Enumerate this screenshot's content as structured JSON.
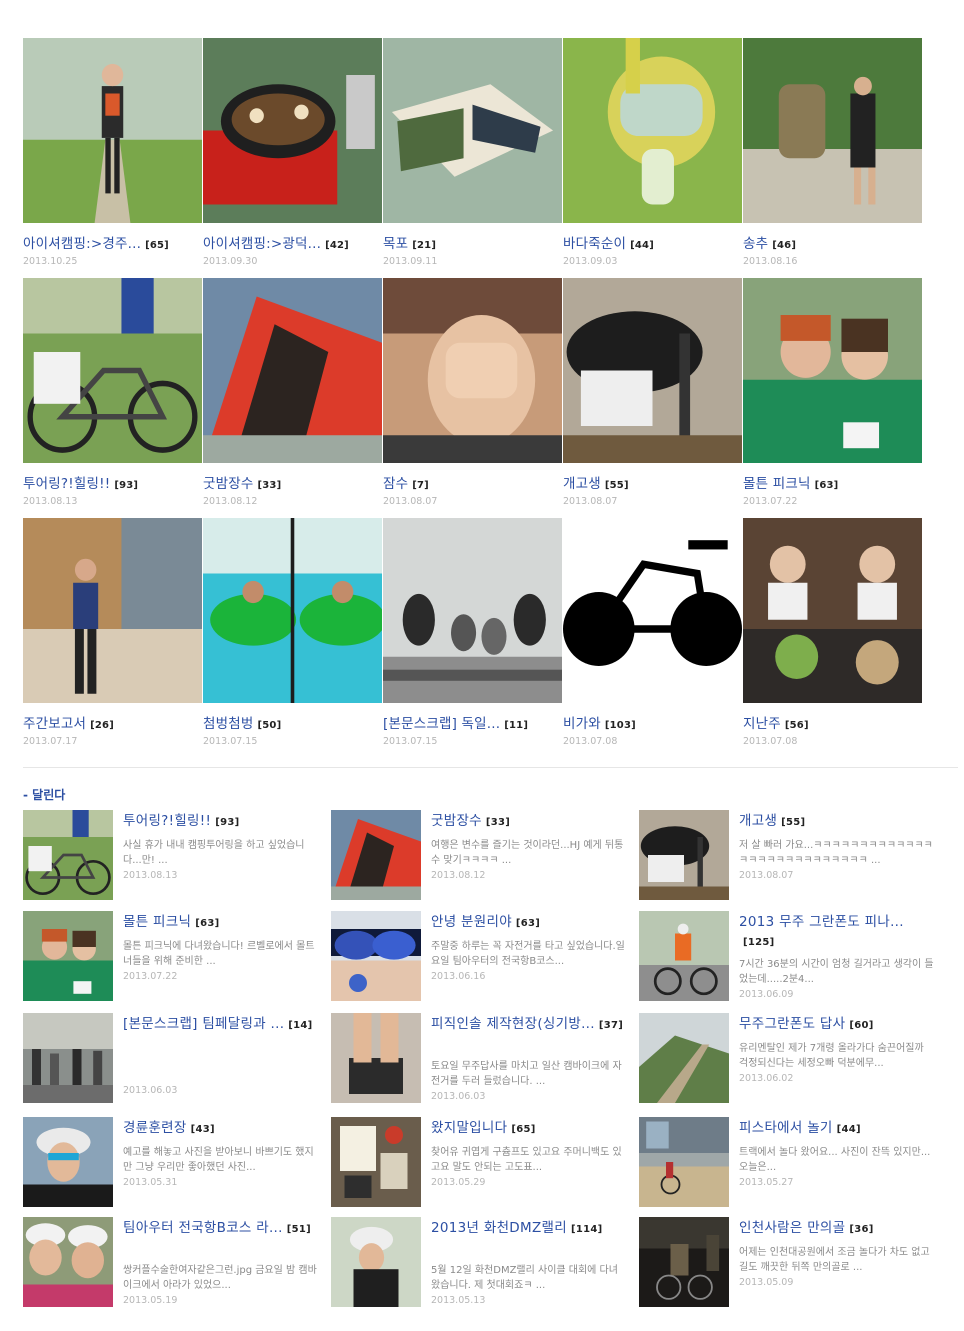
{
  "grid": [
    {
      "title": "아이셔캠핑:>경주...",
      "count": "[65]",
      "date": "2013.10.25",
      "icon": "photo-woman-field"
    },
    {
      "title": "아이셔캠핑:>광덕...",
      "count": "[42]",
      "date": "2013.09.30",
      "icon": "photo-grill-pan"
    },
    {
      "title": "목포",
      "count": "[21]",
      "date": "2013.09.11",
      "icon": "photo-magazine"
    },
    {
      "title": "바다죽순이",
      "count": "[44]",
      "date": "2013.09.03",
      "icon": "photo-snorkel"
    },
    {
      "title": "송추",
      "count": "[46]",
      "date": "2013.08.16",
      "icon": "photo-hikers"
    },
    {
      "title": "투어링?!힐링!!",
      "count": "[93]",
      "date": "2013.08.13",
      "icon": "photo-bicycle"
    },
    {
      "title": "굿밤장수",
      "count": "[33]",
      "date": "2013.08.12",
      "icon": "photo-red-tent"
    },
    {
      "title": "잠수",
      "count": "[7]",
      "date": "2013.08.07",
      "icon": "photo-face-hand"
    },
    {
      "title": "개고생",
      "count": "[55]",
      "date": "2013.08.07",
      "icon": "photo-bike-bag"
    },
    {
      "title": "몰튼 피크닉",
      "count": "[63]",
      "date": "2013.07.22",
      "icon": "photo-two-women"
    },
    {
      "title": "주간보고서",
      "count": "[26]",
      "date": "2013.07.17",
      "icon": "photo-woman-building"
    },
    {
      "title": "첨벙첨벙",
      "count": "[50]",
      "date": "2013.07.15",
      "icon": "photo-pool-tube"
    },
    {
      "title": "[본문스크랩] 독일...",
      "count": "[11]",
      "date": "2013.07.15",
      "icon": "photo-dogs"
    },
    {
      "title": "비가와",
      "count": "[103]",
      "date": "2013.07.08",
      "icon": "photo-bike-silhouette"
    },
    {
      "title": "지난주",
      "count": "[56]",
      "date": "2013.07.08",
      "icon": "photo-cafe"
    }
  ],
  "section": {
    "title": "- 달린다"
  },
  "list": [
    {
      "title": "투어링?!힐링!!",
      "count": "[93]",
      "excerpt": "사실 휴가 내내 캠핑투어링을 하고 싶었습니다...만! ...",
      "date": "2013.08.13",
      "icon": "photo-bicycle"
    },
    {
      "title": "굿밤장수",
      "count": "[33]",
      "excerpt": "여행은 변수를 즐기는 것이라던...HJ 예게 뒤통수 맞기ㅋㅋㅋㅋ ...",
      "date": "2013.08.12",
      "icon": "photo-red-tent"
    },
    {
      "title": "개고생",
      "count": "[55]",
      "excerpt": "저 살 빠러 가요...ㅋㅋㅋㅋㅋㅋㅋㅋㅋㅋㅋㅋㅋㅋㅋㅋㅋㅋㅋㅋㅋㅋㅋㅋㅋㅋㅋ ...",
      "date": "2013.08.07",
      "icon": "photo-bike-bag"
    },
    {
      "title": "몰튼 피크닉",
      "count": "[63]",
      "excerpt": "몰튼 피크닉에 다녀왔습니다! 르벨로에서 몰트너들을 위해 준비한 ...",
      "date": "2013.07.22",
      "icon": "photo-two-women"
    },
    {
      "title": "안녕 분원리야",
      "count": "[63]",
      "excerpt": "주말중 하루는 꼭 자전거를 타고 싶었습니다.일요일 팀아우터의 전국항B코스...",
      "date": "2013.06.16",
      "icon": "photo-goggles"
    },
    {
      "title": "2013 무주 그란폰도 피나...",
      "count": "[125]",
      "excerpt": "7시간 36분의 시간이 엄청 길거라고 생각이 들었는데.....2분4...",
      "date": "2013.06.09",
      "icon": "photo-cyclist-road"
    },
    {
      "title": "[본문스크랩] 팀페달링과 ...",
      "count": "[14]",
      "excerpt": "",
      "date": "2013.06.03",
      "icon": "photo-street-group"
    },
    {
      "title": "피직인솔 제작현장(싱기방...",
      "count": "[37]",
      "excerpt": "토요일 무주답사를 마치고 일산 캠바이크에 자전거를 두러 들렀습니다. ...",
      "date": "2013.06.03",
      "icon": "photo-feet-insole"
    },
    {
      "title": "무주그란폰도 답사",
      "count": "[60]",
      "excerpt": "유리멘탈인 제가 7개령 올라가다 숨끈어질까 걱정되신다는 세정오빠 덕분에무...",
      "date": "2013.06.02",
      "icon": "photo-mountain-road"
    },
    {
      "title": "경륜훈련장",
      "count": "[43]",
      "excerpt": "예고를 해놓고 사진을 받아보니 바쁘기도 했지만 그냥 우리만 좋아했던 사진...",
      "date": "2013.05.31",
      "icon": "photo-helmet-girl"
    },
    {
      "title": "왔지말입니다",
      "count": "[65]",
      "excerpt": "찾어유 귀엽게 구츔프도 있고요 주머니백도 있고요 말도 안되는 고도표...",
      "date": "2013.05.29",
      "icon": "photo-table-items"
    },
    {
      "title": "피스타에서 놀기",
      "count": "[44]",
      "excerpt": "트랙에서 놀다 왔어요... 사진이 잔뜩 있지만... 오늘은...",
      "date": "2013.05.27",
      "icon": "photo-track"
    },
    {
      "title": "팀아우터 전국항B코스 라...",
      "count": "[51]",
      "excerpt": "쌍커플수술한여자같은그런.jpg 금요일 밤 캠바이크에서 아라가 있었으...",
      "date": "2013.05.19",
      "icon": "photo-two-helmets"
    },
    {
      "title": "2013년 화천DMZ랠리",
      "count": "[114]",
      "excerpt": "5월 12일 화천DMZ랠리 사이클 대회에 다녀왔습니다. 제 첫대회죠ㅋ ...",
      "date": "2013.05.13",
      "icon": "photo-rider-close"
    },
    {
      "title": "인천사람은 만의골",
      "count": "[36]",
      "excerpt": "어제는 인천대공원에서 조금 놀다가 차도 없고 길도 깨끗한 뒤쪽 만의골로 ...",
      "date": "2013.05.09",
      "icon": "photo-night-ride"
    }
  ]
}
